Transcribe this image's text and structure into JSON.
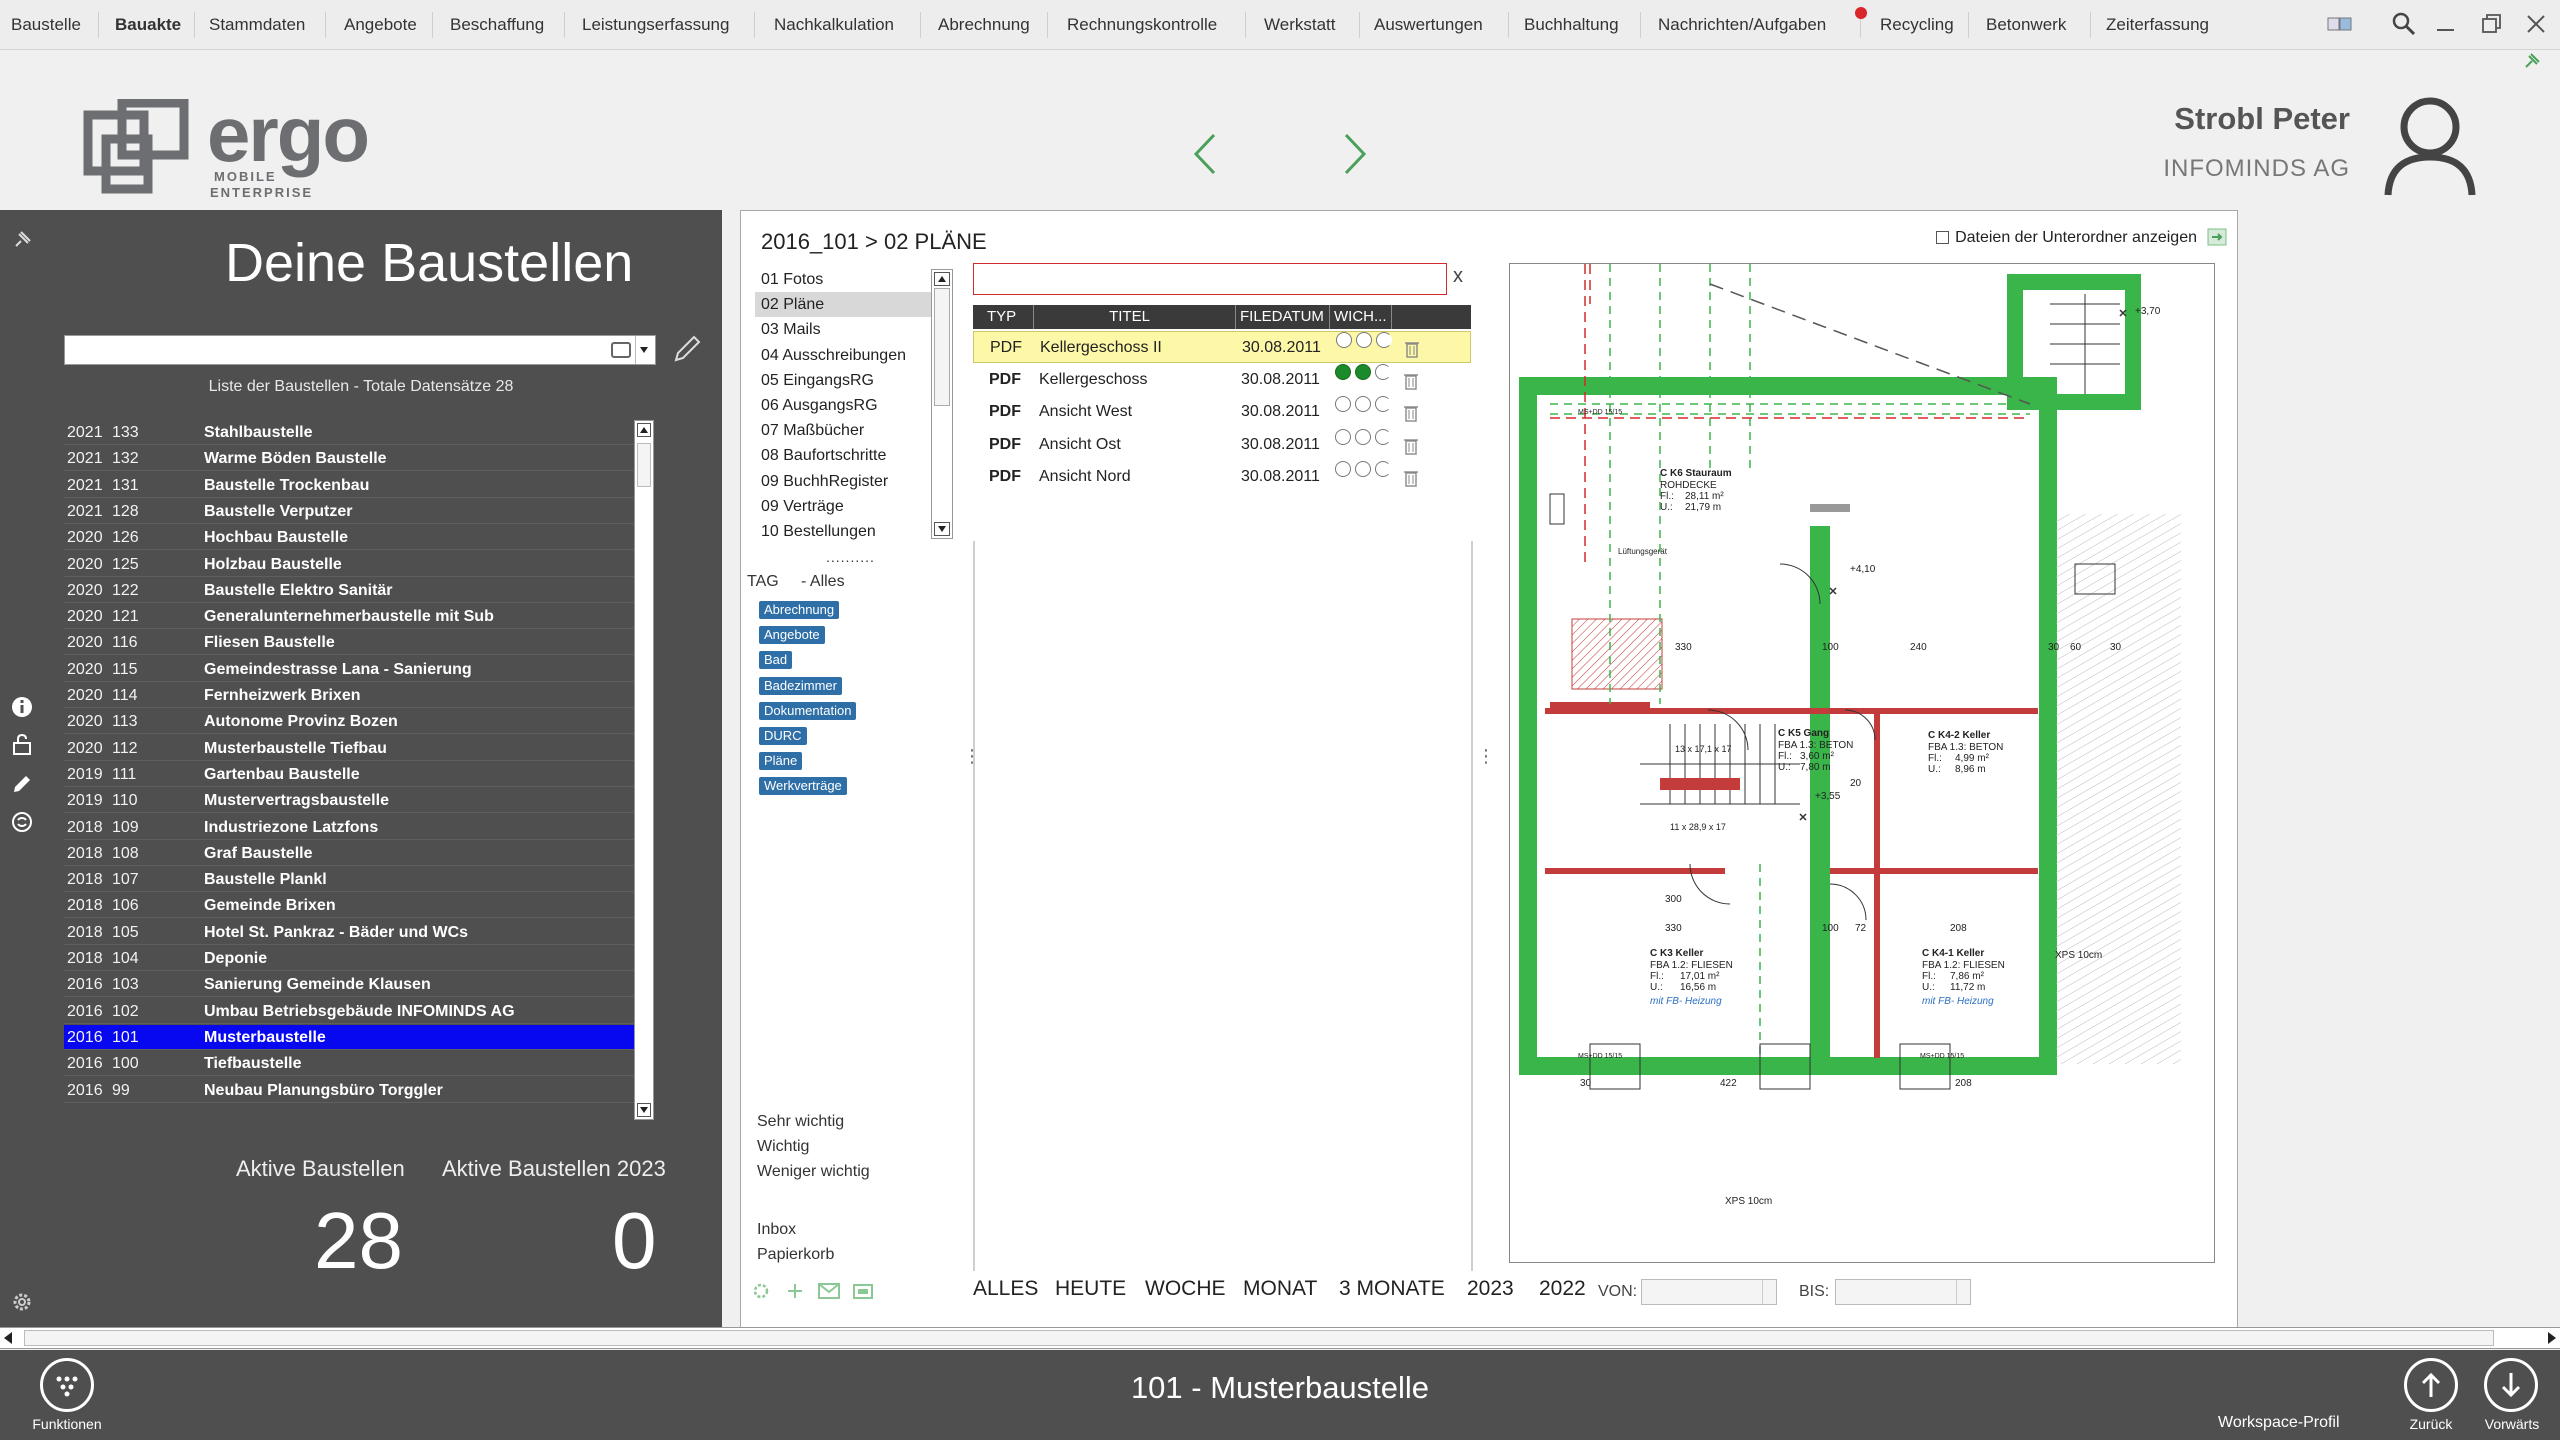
{
  "menu": {
    "items": [
      "Baustelle",
      "Bauakte",
      "Stammdaten",
      "Angebote",
      "Beschaffung",
      "Leistungserfassung",
      "Nachkalkulation",
      "Abrechnung",
      "Rechnungskontrolle",
      "Werkstatt",
      "Auswertungen",
      "Buchhaltung",
      "Nachrichten/Aufgaben",
      "Recycling",
      "Betonwerk",
      "Zeiterfassung"
    ],
    "active": "Bauakte"
  },
  "header": {
    "logo": "ergo",
    "logo_sub1": "MOBILE",
    "logo_sub2": "ENTERPRISE",
    "user_name": "Strobl Peter",
    "company": "INFOMINDS AG"
  },
  "left": {
    "title": "Deine Baustellen",
    "count_text": "Liste der Baustellen - Totale Datensätze 28",
    "rows": [
      {
        "year": "2021",
        "nr": "133",
        "name": "Stahlbaustelle"
      },
      {
        "year": "2021",
        "nr": "132",
        "name": "Warme Böden Baustelle"
      },
      {
        "year": "2021",
        "nr": "131",
        "name": "Baustelle Trockenbau"
      },
      {
        "year": "2021",
        "nr": "128",
        "name": "Baustelle Verputzer"
      },
      {
        "year": "2020",
        "nr": "126",
        "name": "Hochbau Baustelle"
      },
      {
        "year": "2020",
        "nr": "125",
        "name": "Holzbau Baustelle"
      },
      {
        "year": "2020",
        "nr": "122",
        "name": "Baustelle Elektro Sanitär"
      },
      {
        "year": "2020",
        "nr": "121",
        "name": "Generalunternehmerbaustelle mit Sub"
      },
      {
        "year": "2020",
        "nr": "116",
        "name": "Fliesen Baustelle"
      },
      {
        "year": "2020",
        "nr": "115",
        "name": "Gemeindestrasse Lana - Sanierung"
      },
      {
        "year": "2020",
        "nr": "114",
        "name": "Fernheizwerk Brixen"
      },
      {
        "year": "2020",
        "nr": "113",
        "name": "Autonome Provinz Bozen"
      },
      {
        "year": "2020",
        "nr": "112",
        "name": "Musterbaustelle Tiefbau"
      },
      {
        "year": "2019",
        "nr": "111",
        "name": "Gartenbau Baustelle"
      },
      {
        "year": "2019",
        "nr": "110",
        "name": "Mustervertragsbaustelle"
      },
      {
        "year": "2018",
        "nr": "109",
        "name": "Industriezone Latzfons"
      },
      {
        "year": "2018",
        "nr": "108",
        "name": "Graf Baustelle"
      },
      {
        "year": "2018",
        "nr": "107",
        "name": "Baustelle Plankl"
      },
      {
        "year": "2018",
        "nr": "106",
        "name": "Gemeinde Brixen"
      },
      {
        "year": "2018",
        "nr": "105",
        "name": "Hotel St. Pankraz - Bäder und WCs"
      },
      {
        "year": "2018",
        "nr": "104",
        "name": "Deponie"
      },
      {
        "year": "2016",
        "nr": "103",
        "name": "Sanierung Gemeinde Klausen"
      },
      {
        "year": "2016",
        "nr": "102",
        "name": "Umbau Betriebsgebäude INFOMINDS AG"
      },
      {
        "year": "2016",
        "nr": "101",
        "name": "Musterbaustelle"
      },
      {
        "year": "2016",
        "nr": "100",
        "name": "Tiefbaustelle"
      },
      {
        "year": "2016",
        "nr": "99",
        "name": "Neubau Planungsbüro Torggler"
      }
    ],
    "selected_index": 23,
    "stat1_label": "Aktive Baustellen",
    "stat1_value": "28",
    "stat2_label": "Aktive Baustellen 2023",
    "stat2_value": "0"
  },
  "main": {
    "breadcrumb": "2016_101 > 02 PLÄNE",
    "subfolder_label": "Dateien der Unterordner anzeigen",
    "folders": [
      "01 Fotos",
      "02 Pläne",
      "03 Mails",
      "04 Ausschreibungen",
      "05 EingangsRG",
      "06 AusgangsRG",
      "07 Maßbücher",
      "08 Baufortschritte",
      "09 BuchhRegister",
      "09 Verträge",
      "10 Bestellungen"
    ],
    "selected_folder": 1,
    "dots": "..........",
    "tag_label": "TAG",
    "tag_all": "- Alles",
    "tags": [
      "Abrechnung",
      "Angebote",
      "Bad",
      "Badezimmer",
      "Dokumentation",
      "DURC",
      "Pläne",
      "Werkverträge"
    ],
    "priorities": [
      "Sehr wichtig",
      "Wichtig",
      "Weniger wichtig"
    ],
    "special": [
      "Inbox",
      "Papierkorb"
    ],
    "search_clear": "x",
    "table_headers": [
      "TYP",
      "TITEL",
      "FILEDATUM",
      "WICH..."
    ],
    "files": [
      {
        "type": "PDF",
        "title": "Kellergeschoss II",
        "date": "30.08.2011",
        "importance": 0
      },
      {
        "type": "PDF",
        "title": "Kellergeschoss",
        "date": "30.08.2011",
        "importance": 2
      },
      {
        "type": "PDF",
        "title": "Ansicht West",
        "date": "30.08.2011",
        "importance": 0
      },
      {
        "type": "PDF",
        "title": "Ansicht Ost",
        "date": "30.08.2011",
        "importance": 0
      },
      {
        "type": "PDF",
        "title": "Ansicht Nord",
        "date": "30.08.2011",
        "importance": 0
      }
    ],
    "filters": [
      "ALLES",
      "HEUTE",
      "WOCHE",
      "MONAT",
      "3 MONATE",
      "2023",
      "2022"
    ],
    "von_label": "VON:",
    "bis_label": "BIS:"
  },
  "drawing": {
    "rooms": [
      {
        "name": "C K6 Stauraum",
        "l1": "ROHDECKE",
        "l2": "Fl.:",
        "v2": "28,11 m²",
        "l3": "U.:",
        "v3": "21,79 m"
      },
      {
        "name": "C K5 Gang",
        "l1": "FBA 1.3: BETON",
        "l2": "Fl.:",
        "v2": "3,60 m²",
        "l3": "U.:",
        "v3": "7,80 m"
      },
      {
        "name": "C K4-2 Keller",
        "l1": "FBA 1.3: BETON",
        "l2": "Fl.:",
        "v2": "4,99 m²",
        "l3": "U.:",
        "v3": "8,96 m"
      },
      {
        "name": "C K3 Keller",
        "l1": "FBA 1.2: FLIESEN",
        "l2": "Fl.:",
        "v2": "17,01 m²",
        "l3": "U.:",
        "v3": "16,56 m"
      },
      {
        "name": "C K4-1 Keller",
        "l1": "FBA 1.2: FLIESEN",
        "l2": "Fl.:",
        "v2": "7,86 m²",
        "l3": "U.:",
        "v3": "11,72 m"
      }
    ],
    "heating": "mit FB- Heizung",
    "elev1": "+4,10",
    "elev2": "+3,55",
    "elev3": "+3,70",
    "xps1": "XPS 10cm",
    "xps2": "XPS 10cm",
    "vent": "Lüftungsgerät",
    "dims": [
      "330",
      "100",
      "240",
      "300",
      "330",
      "100",
      "72",
      "208",
      "422",
      "208",
      "30",
      "60",
      "30",
      "30",
      "20"
    ],
    "stairs1": "13 x 17,1 x 17",
    "stairs2": "11 x 28,9 x 17",
    "msdd": "MS+DD 15/15"
  },
  "footer": {
    "functions": "Funktionen",
    "title": "101 - Musterbaustelle",
    "workspace": "Workspace-Profil",
    "back": "Zurück",
    "forward": "Vorwärts"
  },
  "colors": {
    "panel_dark": "#4f4f4f",
    "selection_blue": "#0707f0",
    "tag_blue": "#2f6fa7",
    "row_highlight": "#fdf8a7",
    "wall_green": "#3ab54a",
    "nav_arrow": "#4aa05a"
  }
}
